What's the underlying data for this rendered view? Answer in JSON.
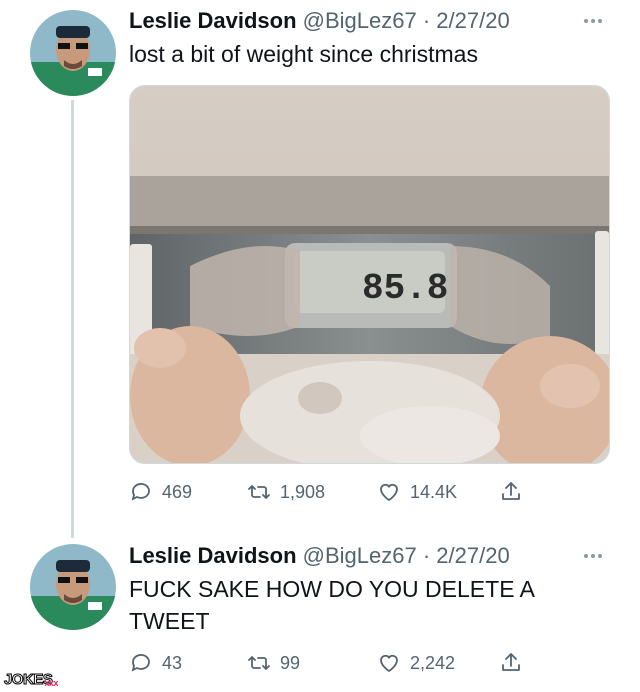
{
  "tweets": [
    {
      "author_name": "Leslie Davidson",
      "handle": "@BigLez67",
      "separator": "·",
      "date": "2/27/20",
      "text": "lost a bit of weight since christmas",
      "scale_reading": "85.8",
      "stats": {
        "replies": "469",
        "retweets": "1,908",
        "likes": "14.4K"
      }
    },
    {
      "author_name": "Leslie Davidson",
      "handle": "@BigLez67",
      "separator": "·",
      "date": "2/27/20",
      "text": "FUCK SAKE HOW DO YOU DELETE A TWEET",
      "stats": {
        "replies": "43",
        "retweets": "99",
        "likes": "2,242"
      }
    }
  ],
  "watermark": {
    "main": "JOKES",
    "sub": "xxx"
  },
  "icons": [
    "more-icon",
    "reply-icon",
    "retweet-icon",
    "like-icon",
    "share-icon"
  ],
  "colors": {
    "text": "#0f1419",
    "secondary": "#536471",
    "thread": "#cfd9de",
    "watermark_accent": "#e0245e"
  }
}
